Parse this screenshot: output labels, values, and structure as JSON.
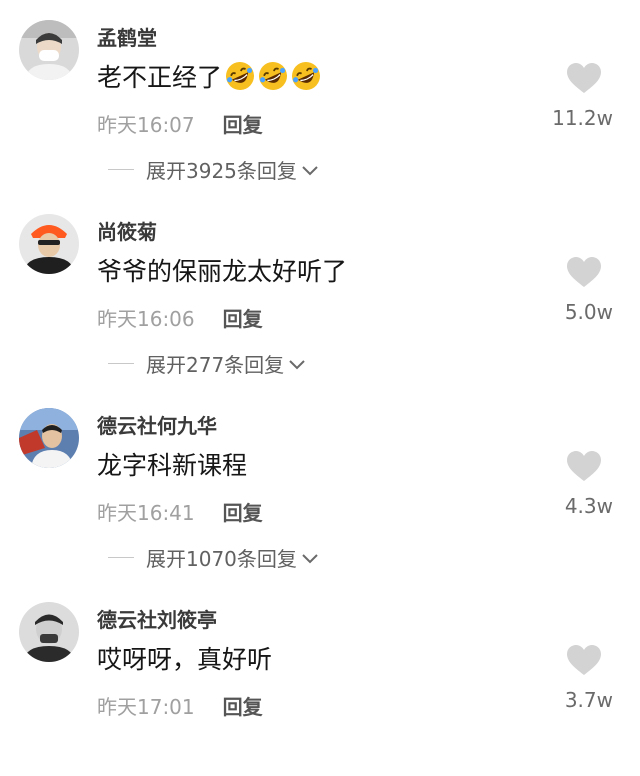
{
  "comments": [
    {
      "username": "孟鹤堂",
      "content": "老不正经了",
      "emoji": [
        "rofl-emoji",
        "rofl-emoji",
        "rofl-emoji"
      ],
      "time": "昨天16:07",
      "reply_label": "回复",
      "expand_label": "展开3925条回复",
      "likes": "11.2w"
    },
    {
      "username": "尚筱菊",
      "content": "爷爷的保丽龙太好听了",
      "emoji": [],
      "time": "昨天16:06",
      "reply_label": "回复",
      "expand_label": "展开277条回复",
      "likes": "5.0w"
    },
    {
      "username": "德云社何九华",
      "content": "龙字科新课程",
      "emoji": [],
      "time": "昨天16:41",
      "reply_label": "回复",
      "expand_label": "展开1070条回复",
      "likes": "4.3w"
    },
    {
      "username": "德云社刘筱亭",
      "content": "哎呀呀，真好听",
      "emoji": [],
      "time": "昨天17:01",
      "reply_label": "回复",
      "expand_label": "",
      "likes": "3.7w"
    }
  ],
  "icons": {
    "like": "heart-icon",
    "expand": "chevron-down-icon"
  },
  "colors": {
    "heart": "#d3d3d3",
    "username": "#3a3a3a",
    "time": "#a0a0a0",
    "emoji_face": "#f7c020"
  }
}
